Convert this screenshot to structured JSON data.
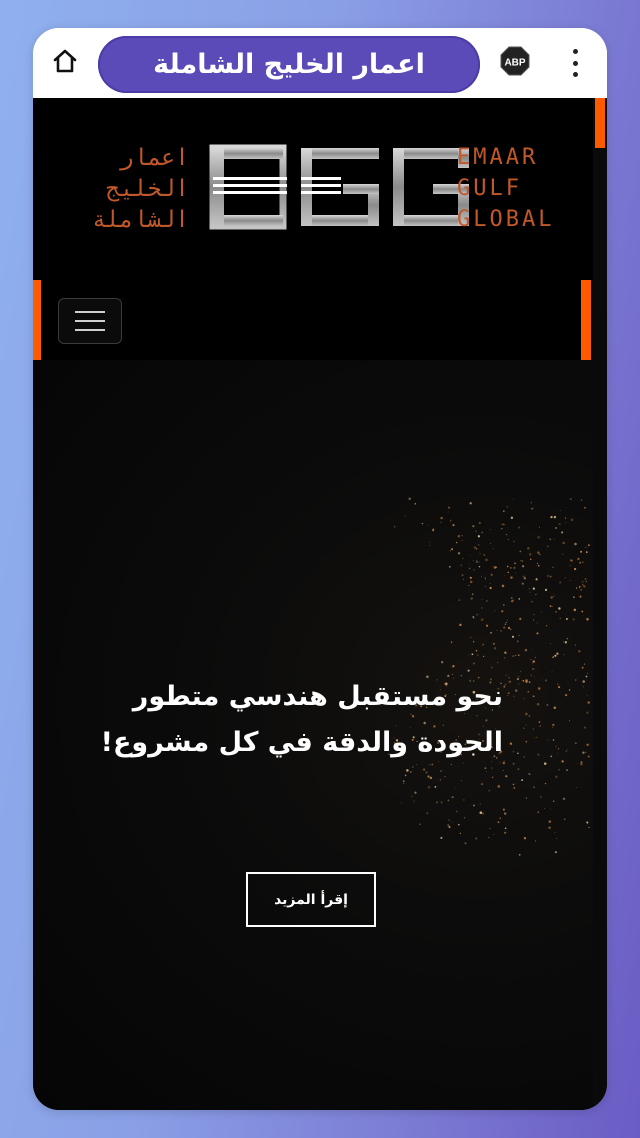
{
  "browser": {
    "title": "اعمار الخليج الشاملة",
    "home_icon": "home-icon",
    "adblock_label": "ABP",
    "menu_icon": "more-vertical-icon"
  },
  "site": {
    "logo": {
      "arabic_lines": [
        "اعمار",
        "الخليج",
        "الشاملة"
      ],
      "mark": "EGG",
      "english_lines": [
        "EMAAR",
        "GULF",
        "GLOBAL"
      ],
      "color": "#c0582a"
    },
    "accent_color": "#ff5a00",
    "nav_toggle_icon": "hamburger-icon"
  },
  "hero": {
    "title_lines": [
      "نحو مستقبل هندسي متطور",
      "الجودة والدقة في كل مشروع!"
    ],
    "cta_label": "إقرأ المزيد"
  }
}
